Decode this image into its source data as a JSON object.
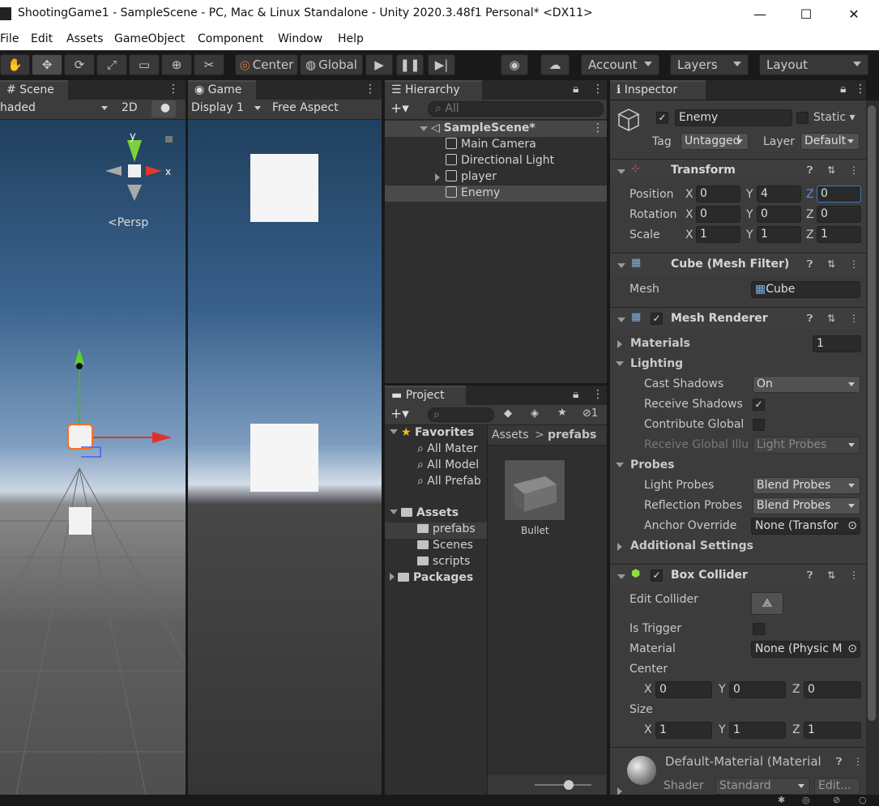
{
  "titlebar": {
    "title": "ShootingGame1 - SampleScene - PC, Mac & Linux Standalone - Unity 2020.3.48f1 Personal* <DX11>",
    "minimize": "—",
    "maximize": "☐",
    "close": "✕"
  },
  "menu": [
    "File",
    "Edit",
    "Assets",
    "GameObject",
    "Component",
    "Window",
    "Help"
  ],
  "toolbar": {
    "center": "Center",
    "global": "Global",
    "account": "Account",
    "layers": "Layers",
    "layout": "Layout"
  },
  "scene": {
    "tab": "Scene",
    "shading": "haded",
    "mode2d": "2D",
    "persp": "<Persp"
  },
  "game": {
    "tab": "Game",
    "display": "Display 1",
    "aspect": "Free Aspect"
  },
  "hierarchy": {
    "tab": "Hierarchy",
    "search_placeholder": "All",
    "scene_name": "SampleScene*",
    "items": [
      "Main Camera",
      "Directional Light",
      "player",
      "Enemy"
    ]
  },
  "project": {
    "tab": "Project",
    "favorites": "Favorites",
    "fav_items": [
      "All Mater",
      "All Model",
      "All Prefab"
    ],
    "assets": "Assets",
    "asset_items": [
      "prefabs",
      "Scenes",
      "scripts"
    ],
    "packages": "Packages",
    "breadcrumb_root": "Assets",
    "breadcrumb_sep": ">",
    "breadcrumb_current": "prefabs",
    "hidden_count": "1",
    "files": [
      "Bullet"
    ]
  },
  "inspector": {
    "tab": "Inspector",
    "object_name": "Enemy",
    "static_label": "Static",
    "tag_label": "Tag",
    "tag_value": "Untagged",
    "layer_label": "Layer",
    "layer_value": "Default",
    "transform": {
      "title": "Transform",
      "position_label": "Position",
      "position": [
        "0",
        "4",
        "0"
      ],
      "rotation_label": "Rotation",
      "rotation": [
        "0",
        "0",
        "0"
      ],
      "scale_label": "Scale",
      "scale": [
        "1",
        "1",
        "1"
      ]
    },
    "mesh_filter": {
      "title": "Cube (Mesh Filter)",
      "mesh_label": "Mesh",
      "mesh_value": "Cube"
    },
    "mesh_renderer": {
      "title": "Mesh Renderer",
      "materials_label": "Materials",
      "materials_count": "1",
      "lighting_label": "Lighting",
      "cast_shadows_label": "Cast Shadows",
      "cast_shadows_value": "On",
      "receive_shadows_label": "Receive Shadows",
      "contribute_global_label": "Contribute Global",
      "receive_global_label": "Receive Global Illu",
      "receive_global_value": "Light Probes",
      "probes_label": "Probes",
      "light_probes_label": "Light Probes",
      "light_probes_value": "Blend Probes",
      "reflection_probes_label": "Reflection Probes",
      "reflection_probes_value": "Blend Probes",
      "anchor_override_label": "Anchor Override",
      "anchor_override_value": "None (Transfor",
      "additional_settings_label": "Additional Settings"
    },
    "box_collider": {
      "title": "Box Collider",
      "edit_collider_label": "Edit Collider",
      "is_trigger_label": "Is Trigger",
      "material_label": "Material",
      "material_value": "None (Physic M",
      "center_label": "Center",
      "center": [
        "0",
        "0",
        "0"
      ],
      "size_label": "Size",
      "size": [
        "1",
        "1",
        "1"
      ]
    },
    "material": {
      "name": "Default-Material (Material",
      "shader_label": "Shader",
      "shader_value": "Standard",
      "edit_label": "Edit..."
    }
  },
  "axis_letters": {
    "x": "X",
    "y": "Y",
    "z": "Z",
    "gizmo_y": "y",
    "gizmo_x": "x"
  }
}
